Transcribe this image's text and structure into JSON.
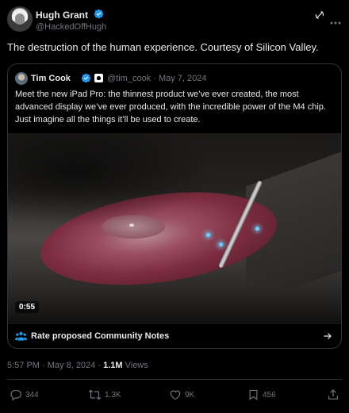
{
  "author": {
    "name": "Hugh Grant",
    "handle": "@HackedOffHugh"
  },
  "tweet": {
    "text": "The destruction of the human experience. Courtesy of Silicon Valley.",
    "time": "5:57 PM",
    "date": "May 8, 2024",
    "views_count": "1.1M",
    "views_label": "Views",
    "separator": " · "
  },
  "quote": {
    "name": "Tim Cook",
    "handle_date": "@tim_cook · May 7, 2024",
    "text": "Meet the new iPad Pro: the thinnest product we’ve ever created, the most advanced display we’ve ever produced, with the incredible power of the M4 chip. Just imagine all the things it’ll be used to create.",
    "video_duration": "0:55"
  },
  "community_notes": {
    "label": "Rate proposed Community Notes"
  },
  "actions": {
    "replies": "344",
    "retweets": "1.3K",
    "likes": "9K",
    "bookmarks": "456"
  },
  "colors": {
    "background": "#000000",
    "text": "#e7e9ea",
    "muted": "#71767b",
    "border": "#2f3336",
    "verified": "#1d9bf0",
    "community_notes": "#1d9bf0"
  },
  "icons": [
    "verified-icon",
    "grok-icon",
    "more-icon",
    "apple-badge-icon",
    "community-notes-icon",
    "arrow-right-icon",
    "reply-icon",
    "retweet-icon",
    "like-icon",
    "bookmark-icon",
    "share-icon"
  ]
}
